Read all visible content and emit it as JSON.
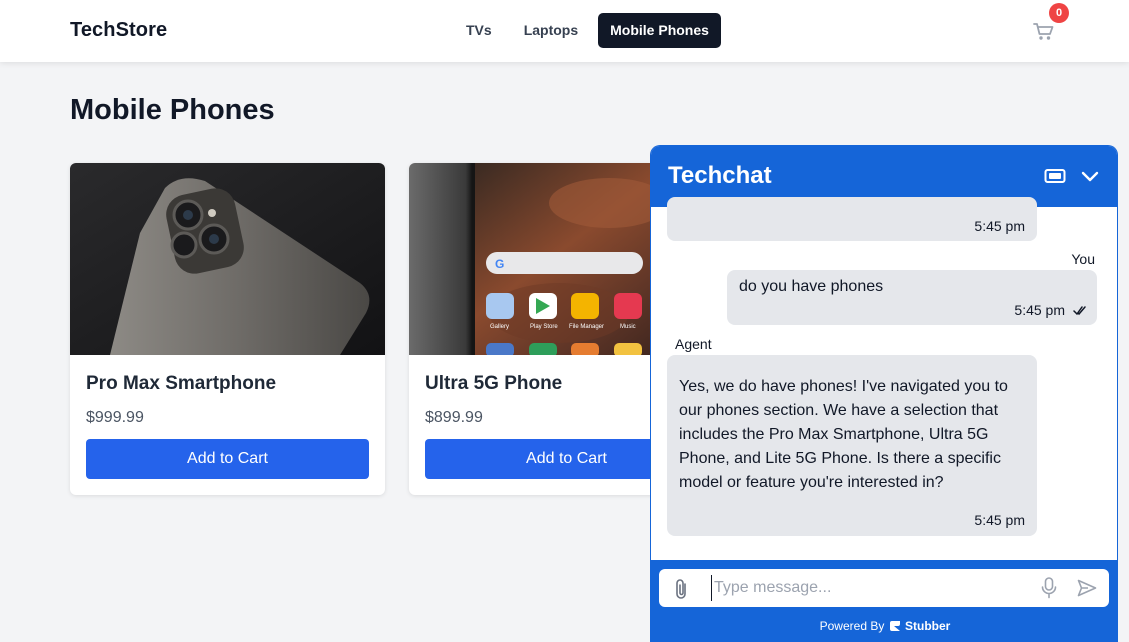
{
  "header": {
    "brand": "TechStore",
    "nav": [
      {
        "label": "TVs",
        "active": false
      },
      {
        "label": "Laptops",
        "active": false
      },
      {
        "label": "Mobile Phones",
        "active": true
      }
    ],
    "cart_icon": "shopping-cart-icon",
    "cart_count": "0"
  },
  "main": {
    "title": "Mobile Phones",
    "products": [
      {
        "name": "Pro Max Smartphone",
        "price": "$999.99",
        "button": "Add to Cart"
      },
      {
        "name": "Ultra 5G Phone",
        "price": "$899.99",
        "button": "Add to Cart"
      }
    ]
  },
  "chat": {
    "title": "Techchat",
    "header_icons": [
      "ticket-icon",
      "chevron-down-icon"
    ],
    "messages": [
      {
        "sender": "",
        "text": "",
        "time": "5:45 pm",
        "side": "agent"
      },
      {
        "sender": "You",
        "text": "do you have phones",
        "time": "5:45 pm",
        "side": "user",
        "read": true
      },
      {
        "sender": "Agent",
        "lines": [
          "Yes, we do have phones! I've navigated you to",
          "our phones section. We have a selection that",
          "includes the Pro Max Smartphone, Ultra 5G",
          "Phone, and Lite 5G Phone. Is there a specific",
          "model or feature you're interested in?"
        ],
        "time": "5:45 pm",
        "side": "agent"
      }
    ],
    "input": {
      "placeholder": "Type message...",
      "value": ""
    },
    "footer_icons": [
      "paperclip-icon",
      "microphone-icon",
      "send-icon"
    ],
    "powered_by": "Powered By",
    "powered_brand": "Stubber"
  },
  "colors": {
    "primary": "#2563eb",
    "chat_blue": "#1565d8",
    "dark": "#111827",
    "badge": "#ef4444",
    "background": "#f3f4f6"
  }
}
